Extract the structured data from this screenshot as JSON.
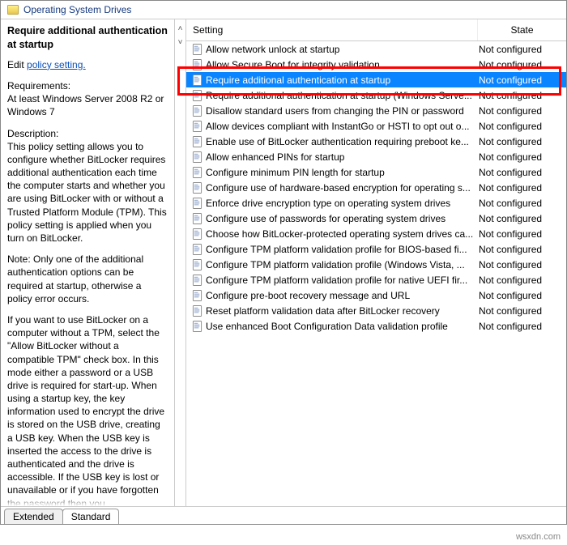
{
  "titlebar": {
    "title": "Operating System Drives"
  },
  "left": {
    "heading": "Require additional authentication at startup",
    "edit_prefix": "Edit ",
    "edit_link": "policy setting.",
    "requirements_label": "Requirements:",
    "requirements_text": "At least Windows Server 2008 R2 or Windows 7",
    "description_label": "Description:",
    "description_p1": "This policy setting allows you to configure whether BitLocker requires additional authentication each time the computer starts and whether you are using BitLocker with or without a Trusted Platform Module (TPM). This policy setting is applied when you turn on BitLocker.",
    "description_p2": "Note: Only one of the additional authentication options can be required at startup, otherwise a policy error occurs.",
    "description_p3": "If you want to use BitLocker on a computer without a TPM, select the \"Allow BitLocker without a compatible TPM\" check box. In this mode either a password or a USB drive is required for start-up. When using a startup key, the key information used to encrypt the drive is stored on the USB drive, creating a USB key. When the USB key is inserted the access to the drive is authenticated and the drive is accessible. If the USB key is lost or unavailable or if you have forgotten the password then you"
  },
  "right": {
    "header_setting": "Setting",
    "header_state": "State",
    "items": [
      {
        "name": "Allow network unlock at startup",
        "state": "Not configured",
        "selected": false
      },
      {
        "name": "Allow Secure Boot for integrity validation",
        "state": "Not configured",
        "selected": false
      },
      {
        "name": "Require additional authentication at startup",
        "state": "Not configured",
        "selected": true
      },
      {
        "name": "Require additional authentication at startup (Windows Serve...",
        "state": "Not configured",
        "selected": false
      },
      {
        "name": "Disallow standard users from changing the PIN or password",
        "state": "Not configured",
        "selected": false
      },
      {
        "name": "Allow devices compliant with InstantGo or HSTI to opt out o...",
        "state": "Not configured",
        "selected": false
      },
      {
        "name": "Enable use of BitLocker authentication requiring preboot ke...",
        "state": "Not configured",
        "selected": false
      },
      {
        "name": "Allow enhanced PINs for startup",
        "state": "Not configured",
        "selected": false
      },
      {
        "name": "Configure minimum PIN length for startup",
        "state": "Not configured",
        "selected": false
      },
      {
        "name": "Configure use of hardware-based encryption for operating s...",
        "state": "Not configured",
        "selected": false
      },
      {
        "name": "Enforce drive encryption type on operating system drives",
        "state": "Not configured",
        "selected": false
      },
      {
        "name": "Configure use of passwords for operating system drives",
        "state": "Not configured",
        "selected": false
      },
      {
        "name": "Choose how BitLocker-protected operating system drives ca...",
        "state": "Not configured",
        "selected": false
      },
      {
        "name": "Configure TPM platform validation profile for BIOS-based fi...",
        "state": "Not configured",
        "selected": false
      },
      {
        "name": "Configure TPM platform validation profile (Windows Vista, ...",
        "state": "Not configured",
        "selected": false
      },
      {
        "name": "Configure TPM platform validation profile for native UEFI fir...",
        "state": "Not configured",
        "selected": false
      },
      {
        "name": "Configure pre-boot recovery message and URL",
        "state": "Not configured",
        "selected": false
      },
      {
        "name": "Reset platform validation data after BitLocker recovery",
        "state": "Not configured",
        "selected": false
      },
      {
        "name": "Use enhanced Boot Configuration Data validation profile",
        "state": "Not configured",
        "selected": false
      }
    ]
  },
  "tabs": {
    "extended": "Extended",
    "standard": "Standard"
  },
  "footer": {
    "watermark": "wsxdn.com"
  }
}
